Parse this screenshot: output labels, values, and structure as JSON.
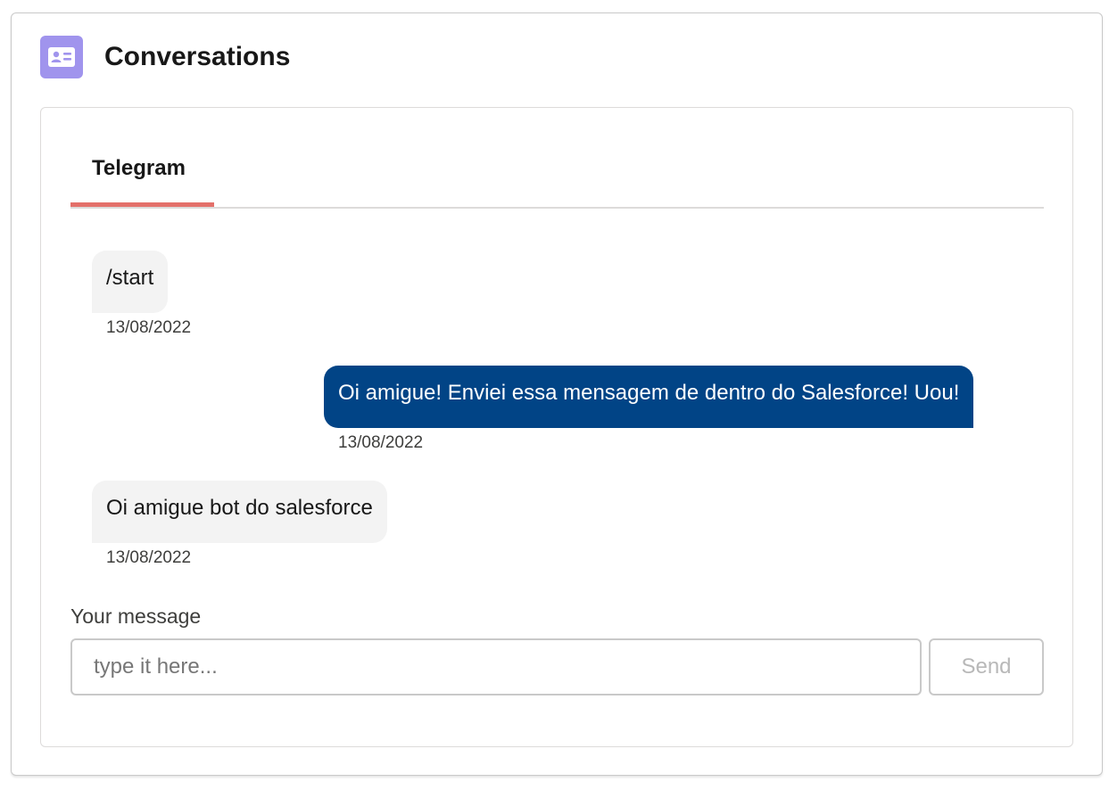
{
  "card": {
    "title": "Conversations",
    "icon": "contact-card-icon",
    "icon_color": "#a094ed"
  },
  "tabs": [
    {
      "label": "Telegram",
      "active": true
    }
  ],
  "messages": [
    {
      "direction": "inbound",
      "text": "/start",
      "date": "13/08/2022"
    },
    {
      "direction": "outbound",
      "text": "Oi amigue! Enviei essa mensagem de dentro do Salesforce! Uou!",
      "date": "13/08/2022"
    },
    {
      "direction": "inbound",
      "text": "Oi amigue bot do salesforce",
      "date": "13/08/2022"
    }
  ],
  "composer": {
    "label": "Your message",
    "placeholder": "type it here...",
    "value": "",
    "send_label": "Send"
  },
  "colors": {
    "outbound_bubble": "#014486",
    "inbound_bubble": "#f3f3f3",
    "active_tab_underline": "#e3706a"
  }
}
